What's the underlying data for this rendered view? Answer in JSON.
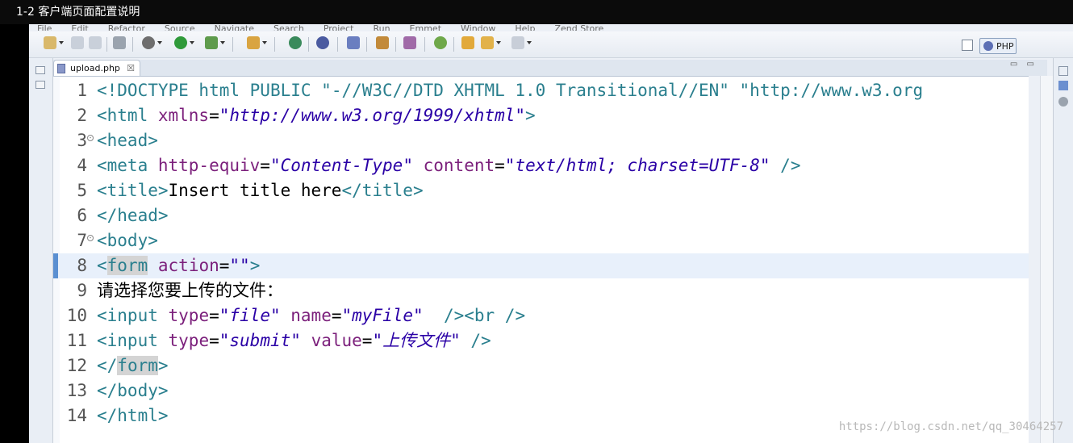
{
  "video_title": "1-2 客户端页面配置说明",
  "menu": [
    "File",
    "Edit",
    "Refactor",
    "Source",
    "Navigate",
    "Search",
    "Project",
    "Run",
    "Emmet",
    "Window",
    "Help",
    "Zend Store"
  ],
  "perspective": {
    "label": "PHP"
  },
  "tab": {
    "label": "upload.php",
    "close": "☒"
  },
  "view_controls": "▭ ▭",
  "code_lines": [
    {
      "num": "1",
      "fold": false,
      "segments": [
        {
          "t": "t",
          "v": "<!DOCTYPE html "
        },
        {
          "t": "k",
          "v": "PUBLIC "
        },
        {
          "t": "t",
          "v": "\"-//W3C//DTD XHTML 1.0 Transitional//EN\" \"http://www.w3.org"
        }
      ]
    },
    {
      "num": "2",
      "fold": false,
      "segments": [
        {
          "t": "t",
          "v": "<html "
        },
        {
          "t": "a",
          "v": "xmlns"
        },
        {
          "t": "",
          "v": "="
        },
        {
          "t": "s",
          "v": "\"http://www.w3.org/1999/xhtml\""
        },
        {
          "t": "t",
          "v": ">"
        }
      ]
    },
    {
      "num": "3",
      "fold": true,
      "segments": [
        {
          "t": "t",
          "v": "<head>"
        }
      ]
    },
    {
      "num": "4",
      "fold": false,
      "segments": [
        {
          "t": "t",
          "v": "<meta "
        },
        {
          "t": "a",
          "v": "http-equiv"
        },
        {
          "t": "",
          "v": "="
        },
        {
          "t": "s",
          "v": "\"Content-Type\""
        },
        {
          "t": "",
          "v": " "
        },
        {
          "t": "a",
          "v": "content"
        },
        {
          "t": "",
          "v": "="
        },
        {
          "t": "s",
          "v": "\"text/html; charset=UTF-8\""
        },
        {
          "t": "t",
          "v": " />"
        }
      ]
    },
    {
      "num": "5",
      "fold": false,
      "segments": [
        {
          "t": "t",
          "v": "<title>"
        },
        {
          "t": "",
          "v": "Insert title here"
        },
        {
          "t": "t",
          "v": "</title>"
        }
      ]
    },
    {
      "num": "6",
      "fold": false,
      "segments": [
        {
          "t": "t",
          "v": "</head>"
        }
      ]
    },
    {
      "num": "7",
      "fold": true,
      "segments": [
        {
          "t": "t",
          "v": "<body>"
        }
      ]
    },
    {
      "num": "8",
      "fold": false,
      "current": true,
      "segments": [
        {
          "t": "t",
          "v": "<"
        },
        {
          "t": "t hl",
          "v": "form"
        },
        {
          "t": "",
          "v": " "
        },
        {
          "t": "a",
          "v": "action"
        },
        {
          "t": "",
          "v": "="
        },
        {
          "t": "s",
          "v": "\"\""
        },
        {
          "t": "t",
          "v": ">"
        }
      ]
    },
    {
      "num": "9",
      "fold": false,
      "segments": [
        {
          "t": "",
          "v": "请选择您要上传的文件："
        }
      ]
    },
    {
      "num": "10",
      "fold": false,
      "segments": [
        {
          "t": "t",
          "v": "<input "
        },
        {
          "t": "a",
          "v": "type"
        },
        {
          "t": "",
          "v": "="
        },
        {
          "t": "s",
          "v": "\"file\""
        },
        {
          "t": "",
          "v": " "
        },
        {
          "t": "a",
          "v": "name"
        },
        {
          "t": "",
          "v": "="
        },
        {
          "t": "s",
          "v": "\"myFile\""
        },
        {
          "t": "t",
          "v": "  /><br />"
        }
      ]
    },
    {
      "num": "11",
      "fold": false,
      "segments": [
        {
          "t": "t",
          "v": "<input "
        },
        {
          "t": "a",
          "v": "type"
        },
        {
          "t": "",
          "v": "="
        },
        {
          "t": "s",
          "v": "\"submit\""
        },
        {
          "t": "",
          "v": " "
        },
        {
          "t": "a",
          "v": "value"
        },
        {
          "t": "",
          "v": "="
        },
        {
          "t": "s",
          "v": "\"上传文件\""
        },
        {
          "t": "t",
          "v": " />"
        }
      ]
    },
    {
      "num": "12",
      "fold": false,
      "segments": [
        {
          "t": "t",
          "v": "</"
        },
        {
          "t": "t hl",
          "v": "form"
        },
        {
          "t": "t",
          "v": ">"
        }
      ]
    },
    {
      "num": "13",
      "fold": false,
      "segments": [
        {
          "t": "t",
          "v": "</body>"
        }
      ]
    },
    {
      "num": "14",
      "fold": false,
      "segments": [
        {
          "t": "t",
          "v": "</html>"
        }
      ]
    }
  ],
  "watermark": "https://blog.csdn.net/qq_30464257",
  "colors": {
    "tag": "#2a7f8e",
    "attr": "#7b1f7b",
    "string": "#2a00a6",
    "current_line": "#e8f0fb"
  }
}
